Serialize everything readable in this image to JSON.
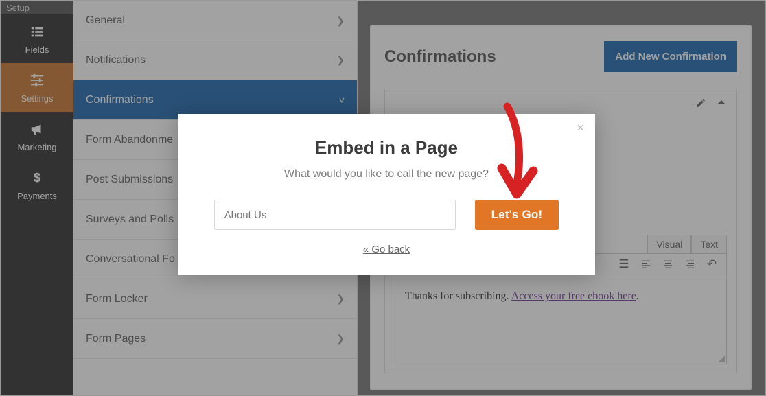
{
  "leftnav": {
    "setup": "Setup",
    "fields": "Fields",
    "settings": "Settings",
    "marketing": "Marketing",
    "payments": "Payments"
  },
  "submenu": {
    "general": "General",
    "notifications": "Notifications",
    "confirmations": "Confirmations",
    "form_abandonment": "Form Abandonme",
    "post_submissions": "Post Submissions",
    "surveys_polls": "Surveys and Polls",
    "conversational": "Conversational Fo",
    "form_locker": "Form Locker",
    "form_pages": "Form Pages"
  },
  "main": {
    "title": "Confirmations",
    "add_button": "Add New Confirmation"
  },
  "editor": {
    "visual_tab": "Visual",
    "text_tab": "Text",
    "body_prefix": "Thanks for subscribing. ",
    "body_link": "Access your free ebook here",
    "body_suffix": "."
  },
  "modal": {
    "title": "Embed in a Page",
    "subtitle": "What would you like to call the new page?",
    "input_value": "About Us",
    "go_label": "Let's Go!",
    "back_label": "« Go back"
  }
}
